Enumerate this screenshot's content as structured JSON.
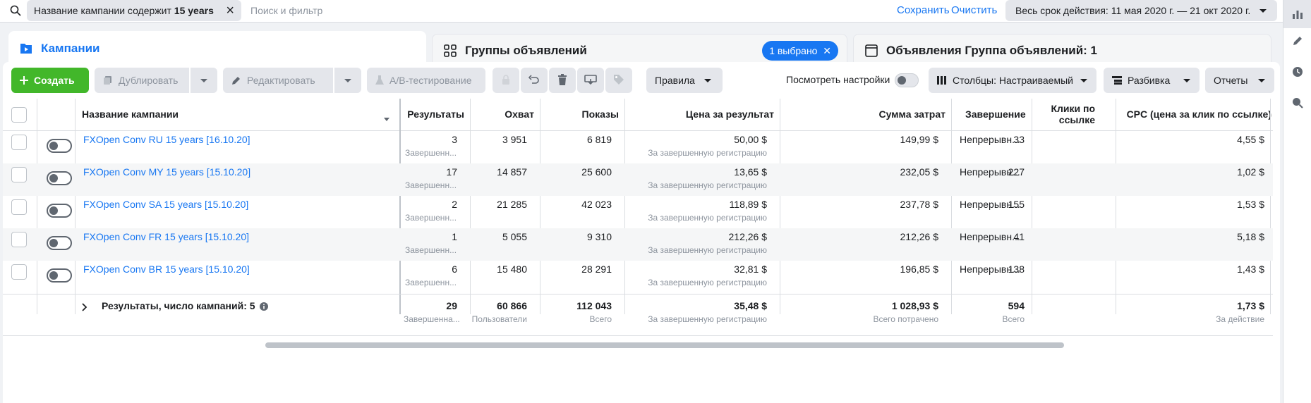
{
  "search": {
    "chip_prefix": "Название кампании содержит",
    "chip_value": "15 years",
    "placeholder": "Поиск и фильтр",
    "save": "Сохранить",
    "clear": "Очистить"
  },
  "date_range": "Весь срок действия: 11 мая 2020 г. — 21 окт 2020 г.",
  "tabs": [
    {
      "label": "Кампании",
      "active": true
    },
    {
      "label": "Группы объявлений",
      "badge": "1 выбрано"
    },
    {
      "label": "Объявления Группа объявлений: 1"
    }
  ],
  "toolbar": {
    "create": "Создать",
    "duplicate": "Дублировать",
    "edit": "Редактировать",
    "ab_test": "A/B-тестирование",
    "rules": "Правила",
    "view_settings": "Посмотреть настройки",
    "columns": "Столбцы: Настраиваемый",
    "breakdown": "Разбивка",
    "reports": "Отчеты"
  },
  "columns": [
    "Название кампании",
    "Результаты",
    "Охват",
    "Показы",
    "Цена за результат",
    "Сумма затрат",
    "Завершение",
    "Клики по ссылке",
    "CPC (цена за клик по ссылке)"
  ],
  "rows": [
    {
      "name": "FXOpen Conv RU 15 years [16.10.20]",
      "results": "3",
      "results_sub": "Завершенн...",
      "reach": "3 951",
      "impressions": "6 819",
      "cpr": "50,00 $",
      "cpr_sub": "За завершенную регистрацию",
      "spent": "149,99 $",
      "ends": "Непрерывн...",
      "clicks": "33",
      "cpc": "4,55 $"
    },
    {
      "name": "FXOpen Conv MY 15 years [15.10.20]",
      "results": "17",
      "results_sub": "Завершенн...",
      "reach": "14 857",
      "impressions": "25 600",
      "cpr": "13,65 $",
      "cpr_sub": "За завершенную регистрацию",
      "spent": "232,05 $",
      "ends": "Непрерывн...",
      "clicks": "227",
      "cpc": "1,02 $"
    },
    {
      "name": "FXOpen Conv SA 15 years [15.10.20]",
      "results": "2",
      "results_sub": "Завершенн...",
      "reach": "21 285",
      "impressions": "42 023",
      "cpr": "118,89 $",
      "cpr_sub": "За завершенную регистрацию",
      "spent": "237,78 $",
      "ends": "Непрерывн...",
      "clicks": "155",
      "cpc": "1,53 $"
    },
    {
      "name": "FXOpen Conv FR 15 years [15.10.20]",
      "results": "1",
      "results_sub": "Завершенн...",
      "reach": "5 055",
      "impressions": "9 310",
      "cpr": "212,26 $",
      "cpr_sub": "За завершенную регистрацию",
      "spent": "212,26 $",
      "ends": "Непрерывн...",
      "clicks": "41",
      "cpc": "5,18 $"
    },
    {
      "name": "FXOpen Conv BR 15 years [15.10.20]",
      "results": "6",
      "results_sub": "Завершенн...",
      "reach": "15 480",
      "impressions": "28 291",
      "cpr": "32,81 $",
      "cpr_sub": "За завершенную регистрацию",
      "spent": "196,85 $",
      "ends": "Непрерывн...",
      "clicks": "138",
      "cpc": "1,43 $"
    }
  ],
  "totals": {
    "label": "Результаты, число кампаний: 5",
    "results": "29",
    "results_sub": "Завершенна...",
    "reach": "60 866",
    "reach_sub": "Пользователи",
    "impressions": "112 043",
    "impressions_sub": "Всего",
    "cpr": "35,48 $",
    "cpr_sub": "За завершенную регистрацию",
    "spent": "1 028,93 $",
    "spent_sub": "Всего потрачено",
    "clicks": "594",
    "clicks_sub": "Всего",
    "cpc": "1,73 $",
    "cpc_sub": "За действие"
  },
  "icons": {
    "search": "search-icon",
    "close": "close-icon",
    "campaign": "campaign-folder-icon",
    "adsets": "adsets-grid-icon",
    "ads": "ad-window-icon",
    "chart": "bar-chart-icon",
    "pencil": "pencil-icon",
    "clock": "clock-icon",
    "zoom": "zoom-icon"
  },
  "colors": {
    "accent": "#1877f2",
    "create": "#42b72a"
  }
}
